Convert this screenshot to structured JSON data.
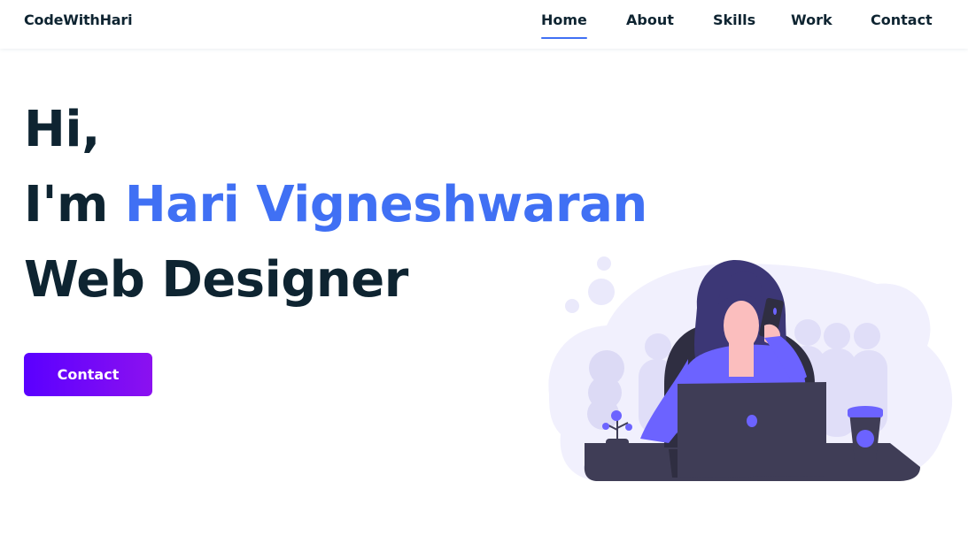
{
  "brand": {
    "logo": "CodeWithHari"
  },
  "nav": {
    "items": [
      {
        "label": "Home",
        "active": true
      },
      {
        "label": "About"
      },
      {
        "label": "Skills"
      },
      {
        "label": "Work"
      },
      {
        "label": "Contact"
      }
    ]
  },
  "hero": {
    "greeting": "Hi,",
    "intro_prefix": "I'm ",
    "name": "Hari Vigneshwaran",
    "role": "Web Designer",
    "cta_label": "Contact"
  },
  "colors": {
    "accent": "#4070f4",
    "text": "#0e2431",
    "button_gradient_start": "#5a00ff",
    "button_gradient_end": "#8b11f0",
    "illustration_purple": "#6c63ff"
  },
  "icons": {
    "illustration": "woman-on-phone-at-laptop-illustration"
  }
}
